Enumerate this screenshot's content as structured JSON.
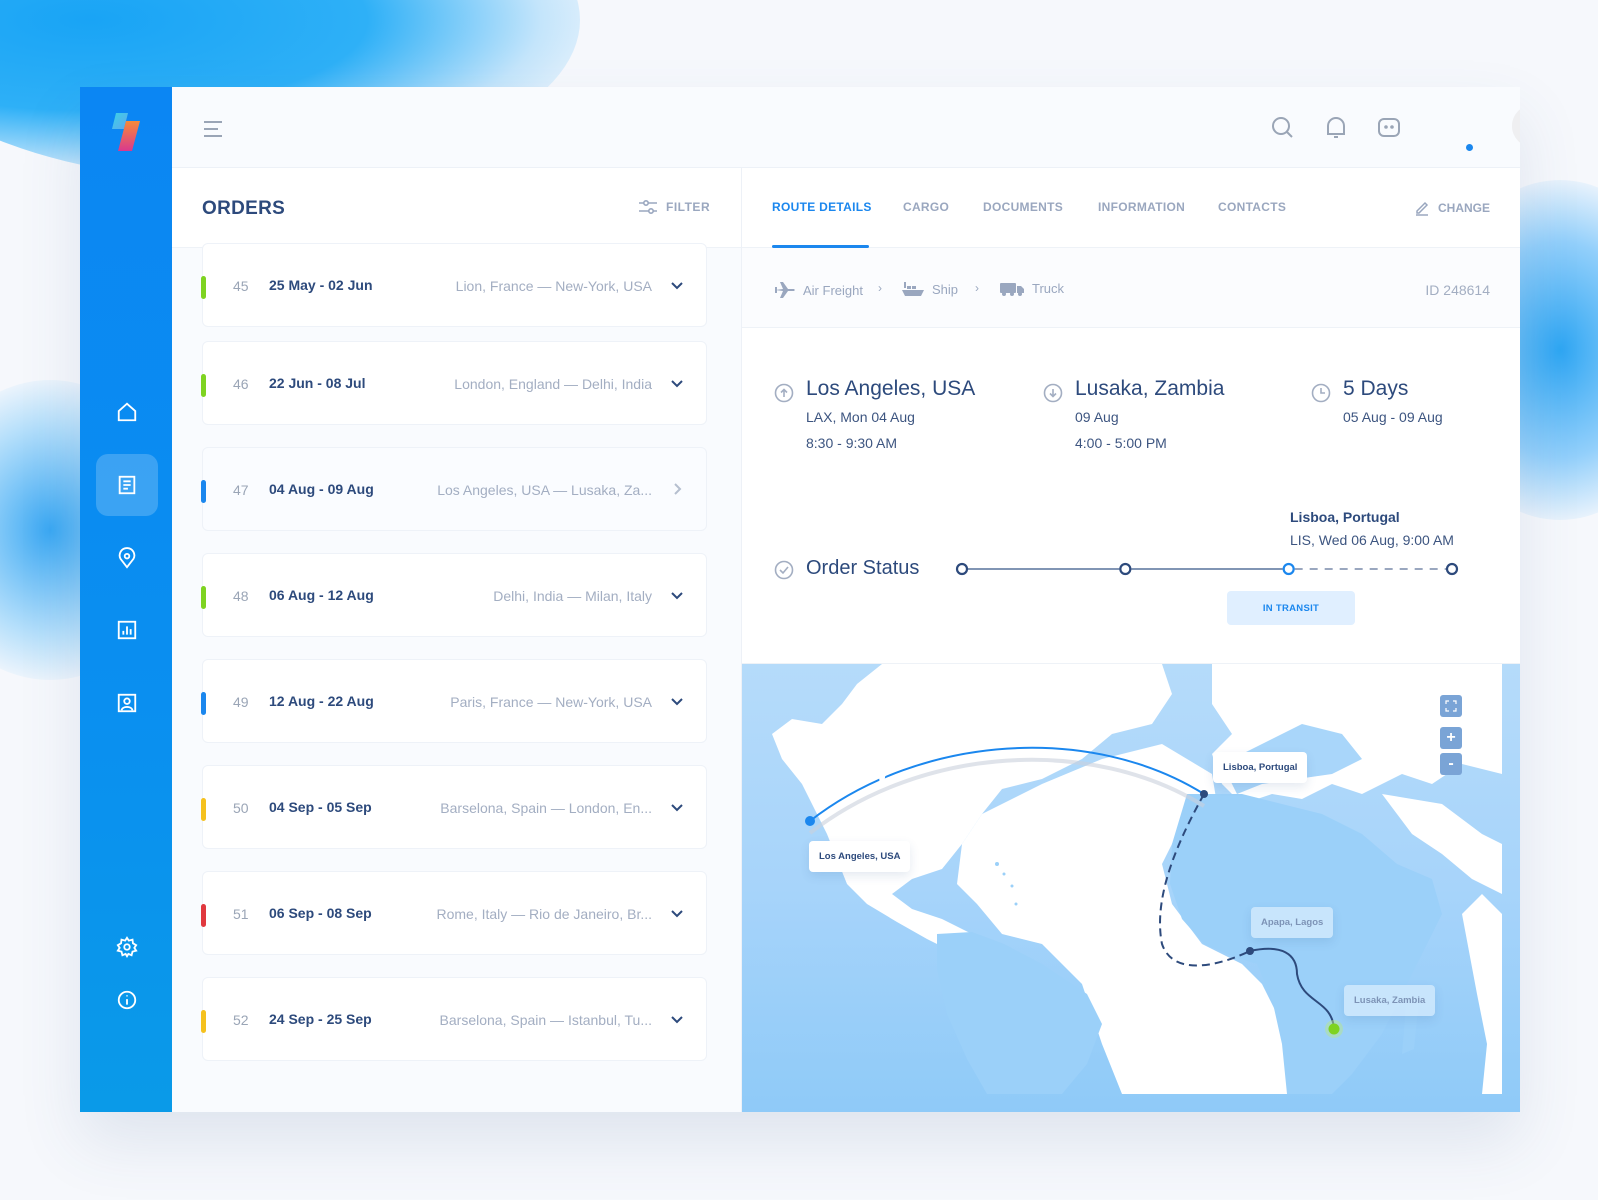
{
  "topbar": {
    "icons": [
      "menu-icon",
      "search-icon",
      "bell-icon",
      "chat-icon"
    ],
    "notification_dot_color": "#1b87ee"
  },
  "sidebar": {
    "items": [
      {
        "name": "home",
        "icon": "home-icon",
        "active": false
      },
      {
        "name": "orders",
        "icon": "document-icon",
        "active": true
      },
      {
        "name": "locations",
        "icon": "location-pin-icon",
        "active": false
      },
      {
        "name": "reports",
        "icon": "bar-chart-icon",
        "active": false
      },
      {
        "name": "contacts",
        "icon": "contact-card-icon",
        "active": false
      }
    ],
    "bottom_items": [
      {
        "name": "settings",
        "icon": "gear-icon"
      },
      {
        "name": "info",
        "icon": "info-icon"
      }
    ],
    "color": "#0b86f3"
  },
  "orders": {
    "title": "ORDERS",
    "filter_label": "FILTER",
    "items": [
      {
        "num": "45",
        "dates": "25 May - 02 Jun",
        "route": "Lion, France — New-York, USA",
        "status_color": "#7ed321",
        "chevron": "down"
      },
      {
        "num": "46",
        "dates": "22 Jun - 08 Jul",
        "route": "London, England — Delhi, India",
        "status_color": "#7ed321",
        "chevron": "down"
      },
      {
        "num": "47",
        "dates": "04 Aug - 09 Aug",
        "route": "Los Angeles, USA — Lusaka, Za...",
        "status_color": "#1b87ee",
        "chevron": "right",
        "selected": true
      },
      {
        "num": "48",
        "dates": "06 Aug - 12 Aug",
        "route": "Delhi, India — Milan, Italy",
        "status_color": "#7ed321",
        "chevron": "down"
      },
      {
        "num": "49",
        "dates": "12 Aug - 22 Aug",
        "route": "Paris, France — New-York, USA",
        "status_color": "#1b87ee",
        "chevron": "down"
      },
      {
        "num": "50",
        "dates": "04 Sep - 05 Sep",
        "route": "Barselona, Spain — London, En...",
        "status_color": "#f5c11e",
        "chevron": "down"
      },
      {
        "num": "51",
        "dates": "06 Sep - 08 Sep",
        "route": "Rome, Italy — Rio de Janeiro, Br...",
        "status_color": "#e0383e",
        "chevron": "down"
      },
      {
        "num": "52",
        "dates": "24 Sep - 25 Sep",
        "route": "Barselona, Spain — Istanbul, Tu...",
        "status_color": "#f5c11e",
        "chevron": "down"
      }
    ]
  },
  "details": {
    "tabs": [
      {
        "label": "ROUTE DETAILS",
        "active": true
      },
      {
        "label": "CARGO",
        "active": false
      },
      {
        "label": "DOCUMENTS",
        "active": false
      },
      {
        "label": "INFORMATION",
        "active": false
      },
      {
        "label": "CONTACTS",
        "active": false
      }
    ],
    "change_label": "CHANGE",
    "transport_modes": [
      {
        "label": "Air Freight",
        "icon": "airplane-icon"
      },
      {
        "label": "Ship",
        "icon": "ship-icon"
      },
      {
        "label": "Truck",
        "icon": "truck-icon"
      }
    ],
    "order_id": "ID 248614",
    "origin": {
      "city": "Los Angeles, USA",
      "date": "LAX, Mon 04 Aug",
      "time": "8:30 - 9:30 AM"
    },
    "destination": {
      "city": "Lusaka, Zambia",
      "date": "09 Aug",
      "time": "4:00 - 5:00 PM"
    },
    "duration": {
      "title": "5 Days",
      "range": "05 Aug - 09 Aug"
    },
    "order_status": {
      "label": "Order Status",
      "current_stop": "Lisboa, Portugal",
      "current_stop_detail": "LIS, Wed 06 Aug, 9:00 AM",
      "badge": "IN TRANSIT",
      "stops_total": 4,
      "current_stop_index": 2
    },
    "map": {
      "labels": {
        "origin": "Los Angeles, USA",
        "transit": "Lisboa, Portugal",
        "port": "Apapa, Lagos",
        "destination": "Lusaka, Zambia"
      },
      "controls": {
        "fullscreen": "fullscreen-icon",
        "zoom_in": "+",
        "zoom_out": "-"
      },
      "route_color": "#1b87ee",
      "destination_color": "#7ed321"
    }
  }
}
